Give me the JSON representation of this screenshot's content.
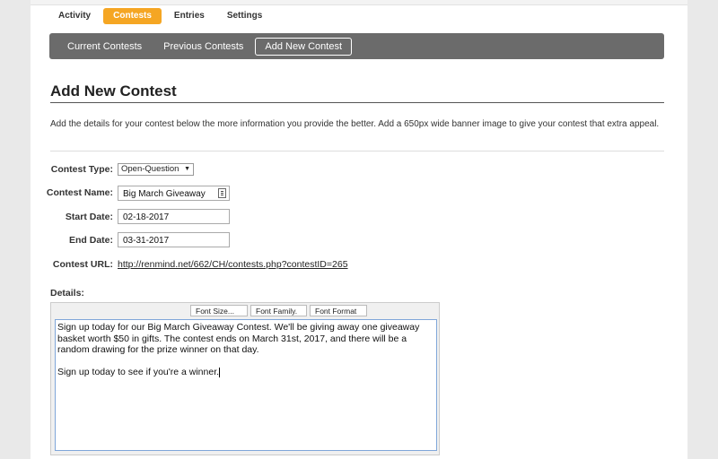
{
  "tabs": [
    {
      "label": "Activity",
      "active": false
    },
    {
      "label": "Contests",
      "active": true
    },
    {
      "label": "Entries",
      "active": false
    },
    {
      "label": "Settings",
      "active": false
    }
  ],
  "subnav": [
    {
      "label": "Current Contests",
      "active": false
    },
    {
      "label": "Previous Contests",
      "active": false
    },
    {
      "label": "Add New Contest",
      "active": true
    }
  ],
  "page_title": "Add New Contest",
  "description": "Add the details for your contest below the more information you provide the better. Add a 650px wide banner image to give your contest that extra appeal.",
  "form": {
    "contest_type_label": "Contest Type:",
    "contest_type_value": "Open-Question",
    "contest_name_label": "Contest Name:",
    "contest_name_value": "Big March Giveaway",
    "start_date_label": "Start Date:",
    "start_date_value": "02-18-2017",
    "end_date_label": "End Date:",
    "end_date_value": "03-31-2017",
    "contest_url_label": "Contest URL:",
    "contest_url_value": "http://renmind.net/662/CH/contests.php?contestID=265"
  },
  "details": {
    "label": "Details:",
    "toolbar": [
      "Font Size...",
      "Font Family.",
      "Font Format"
    ],
    "paragraph1": "Sign up today for our Big March Giveaway Contest. We'll be giving away one giveaway basket worth $50 in gifts. The contest ends on March 31st, 2017, and there will be a random drawing for the prize winner on that day.",
    "paragraph2": "Sign up today to see if you're a winner."
  },
  "colors": {
    "accent": "#f5a623",
    "subnav_bg": "#6b6b6b"
  }
}
